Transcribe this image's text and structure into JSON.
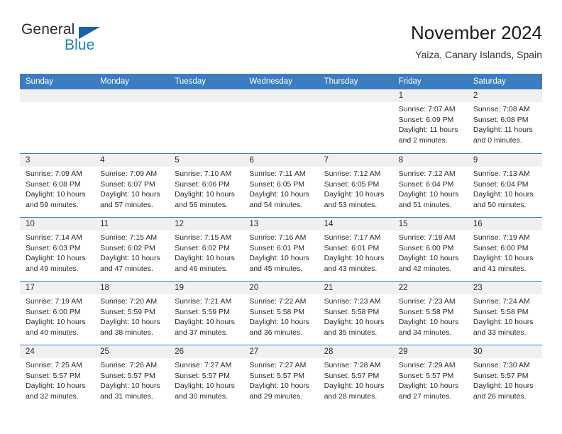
{
  "brand": {
    "name_part1": "General",
    "name_part2": "Blue",
    "triangle_icon": "triangle-icon",
    "colors": {
      "general_text": "#2b2b2b",
      "blue_text": "#1b7fc4",
      "triangle": "#1565a8",
      "header_bar": "#3b7dc0",
      "day_strip": "#f0f0f0"
    }
  },
  "header": {
    "title": "November 2024",
    "subtitle": "Yaiza, Canary Islands, Spain"
  },
  "calendar": {
    "weekdays": [
      "Sunday",
      "Monday",
      "Tuesday",
      "Wednesday",
      "Thursday",
      "Friday",
      "Saturday"
    ],
    "weeks": [
      [
        {
          "date": "",
          "sunrise": "",
          "sunset": "",
          "daylight": "",
          "empty": true
        },
        {
          "date": "",
          "sunrise": "",
          "sunset": "",
          "daylight": "",
          "empty": true
        },
        {
          "date": "",
          "sunrise": "",
          "sunset": "",
          "daylight": "",
          "empty": true
        },
        {
          "date": "",
          "sunrise": "",
          "sunset": "",
          "daylight": "",
          "empty": true
        },
        {
          "date": "",
          "sunrise": "",
          "sunset": "",
          "daylight": "",
          "empty": true
        },
        {
          "date": "1",
          "sunrise": "Sunrise: 7:07 AM",
          "sunset": "Sunset: 6:09 PM",
          "daylight": "Daylight: 11 hours and 2 minutes."
        },
        {
          "date": "2",
          "sunrise": "Sunrise: 7:08 AM",
          "sunset": "Sunset: 6:08 PM",
          "daylight": "Daylight: 11 hours and 0 minutes."
        }
      ],
      [
        {
          "date": "3",
          "sunrise": "Sunrise: 7:09 AM",
          "sunset": "Sunset: 6:08 PM",
          "daylight": "Daylight: 10 hours and 59 minutes."
        },
        {
          "date": "4",
          "sunrise": "Sunrise: 7:09 AM",
          "sunset": "Sunset: 6:07 PM",
          "daylight": "Daylight: 10 hours and 57 minutes."
        },
        {
          "date": "5",
          "sunrise": "Sunrise: 7:10 AM",
          "sunset": "Sunset: 6:06 PM",
          "daylight": "Daylight: 10 hours and 56 minutes."
        },
        {
          "date": "6",
          "sunrise": "Sunrise: 7:11 AM",
          "sunset": "Sunset: 6:05 PM",
          "daylight": "Daylight: 10 hours and 54 minutes."
        },
        {
          "date": "7",
          "sunrise": "Sunrise: 7:12 AM",
          "sunset": "Sunset: 6:05 PM",
          "daylight": "Daylight: 10 hours and 53 minutes."
        },
        {
          "date": "8",
          "sunrise": "Sunrise: 7:12 AM",
          "sunset": "Sunset: 6:04 PM",
          "daylight": "Daylight: 10 hours and 51 minutes."
        },
        {
          "date": "9",
          "sunrise": "Sunrise: 7:13 AM",
          "sunset": "Sunset: 6:04 PM",
          "daylight": "Daylight: 10 hours and 50 minutes."
        }
      ],
      [
        {
          "date": "10",
          "sunrise": "Sunrise: 7:14 AM",
          "sunset": "Sunset: 6:03 PM",
          "daylight": "Daylight: 10 hours and 49 minutes."
        },
        {
          "date": "11",
          "sunrise": "Sunrise: 7:15 AM",
          "sunset": "Sunset: 6:02 PM",
          "daylight": "Daylight: 10 hours and 47 minutes."
        },
        {
          "date": "12",
          "sunrise": "Sunrise: 7:15 AM",
          "sunset": "Sunset: 6:02 PM",
          "daylight": "Daylight: 10 hours and 46 minutes."
        },
        {
          "date": "13",
          "sunrise": "Sunrise: 7:16 AM",
          "sunset": "Sunset: 6:01 PM",
          "daylight": "Daylight: 10 hours and 45 minutes."
        },
        {
          "date": "14",
          "sunrise": "Sunrise: 7:17 AM",
          "sunset": "Sunset: 6:01 PM",
          "daylight": "Daylight: 10 hours and 43 minutes."
        },
        {
          "date": "15",
          "sunrise": "Sunrise: 7:18 AM",
          "sunset": "Sunset: 6:00 PM",
          "daylight": "Daylight: 10 hours and 42 minutes."
        },
        {
          "date": "16",
          "sunrise": "Sunrise: 7:19 AM",
          "sunset": "Sunset: 6:00 PM",
          "daylight": "Daylight: 10 hours and 41 minutes."
        }
      ],
      [
        {
          "date": "17",
          "sunrise": "Sunrise: 7:19 AM",
          "sunset": "Sunset: 6:00 PM",
          "daylight": "Daylight: 10 hours and 40 minutes."
        },
        {
          "date": "18",
          "sunrise": "Sunrise: 7:20 AM",
          "sunset": "Sunset: 5:59 PM",
          "daylight": "Daylight: 10 hours and 38 minutes."
        },
        {
          "date": "19",
          "sunrise": "Sunrise: 7:21 AM",
          "sunset": "Sunset: 5:59 PM",
          "daylight": "Daylight: 10 hours and 37 minutes."
        },
        {
          "date": "20",
          "sunrise": "Sunrise: 7:22 AM",
          "sunset": "Sunset: 5:58 PM",
          "daylight": "Daylight: 10 hours and 36 minutes."
        },
        {
          "date": "21",
          "sunrise": "Sunrise: 7:23 AM",
          "sunset": "Sunset: 5:58 PM",
          "daylight": "Daylight: 10 hours and 35 minutes."
        },
        {
          "date": "22",
          "sunrise": "Sunrise: 7:23 AM",
          "sunset": "Sunset: 5:58 PM",
          "daylight": "Daylight: 10 hours and 34 minutes."
        },
        {
          "date": "23",
          "sunrise": "Sunrise: 7:24 AM",
          "sunset": "Sunset: 5:58 PM",
          "daylight": "Daylight: 10 hours and 33 minutes."
        }
      ],
      [
        {
          "date": "24",
          "sunrise": "Sunrise: 7:25 AM",
          "sunset": "Sunset: 5:57 PM",
          "daylight": "Daylight: 10 hours and 32 minutes."
        },
        {
          "date": "25",
          "sunrise": "Sunrise: 7:26 AM",
          "sunset": "Sunset: 5:57 PM",
          "daylight": "Daylight: 10 hours and 31 minutes."
        },
        {
          "date": "26",
          "sunrise": "Sunrise: 7:27 AM",
          "sunset": "Sunset: 5:57 PM",
          "daylight": "Daylight: 10 hours and 30 minutes."
        },
        {
          "date": "27",
          "sunrise": "Sunrise: 7:27 AM",
          "sunset": "Sunset: 5:57 PM",
          "daylight": "Daylight: 10 hours and 29 minutes."
        },
        {
          "date": "28",
          "sunrise": "Sunrise: 7:28 AM",
          "sunset": "Sunset: 5:57 PM",
          "daylight": "Daylight: 10 hours and 28 minutes."
        },
        {
          "date": "29",
          "sunrise": "Sunrise: 7:29 AM",
          "sunset": "Sunset: 5:57 PM",
          "daylight": "Daylight: 10 hours and 27 minutes."
        },
        {
          "date": "30",
          "sunrise": "Sunrise: 7:30 AM",
          "sunset": "Sunset: 5:57 PM",
          "daylight": "Daylight: 10 hours and 26 minutes."
        }
      ]
    ]
  }
}
